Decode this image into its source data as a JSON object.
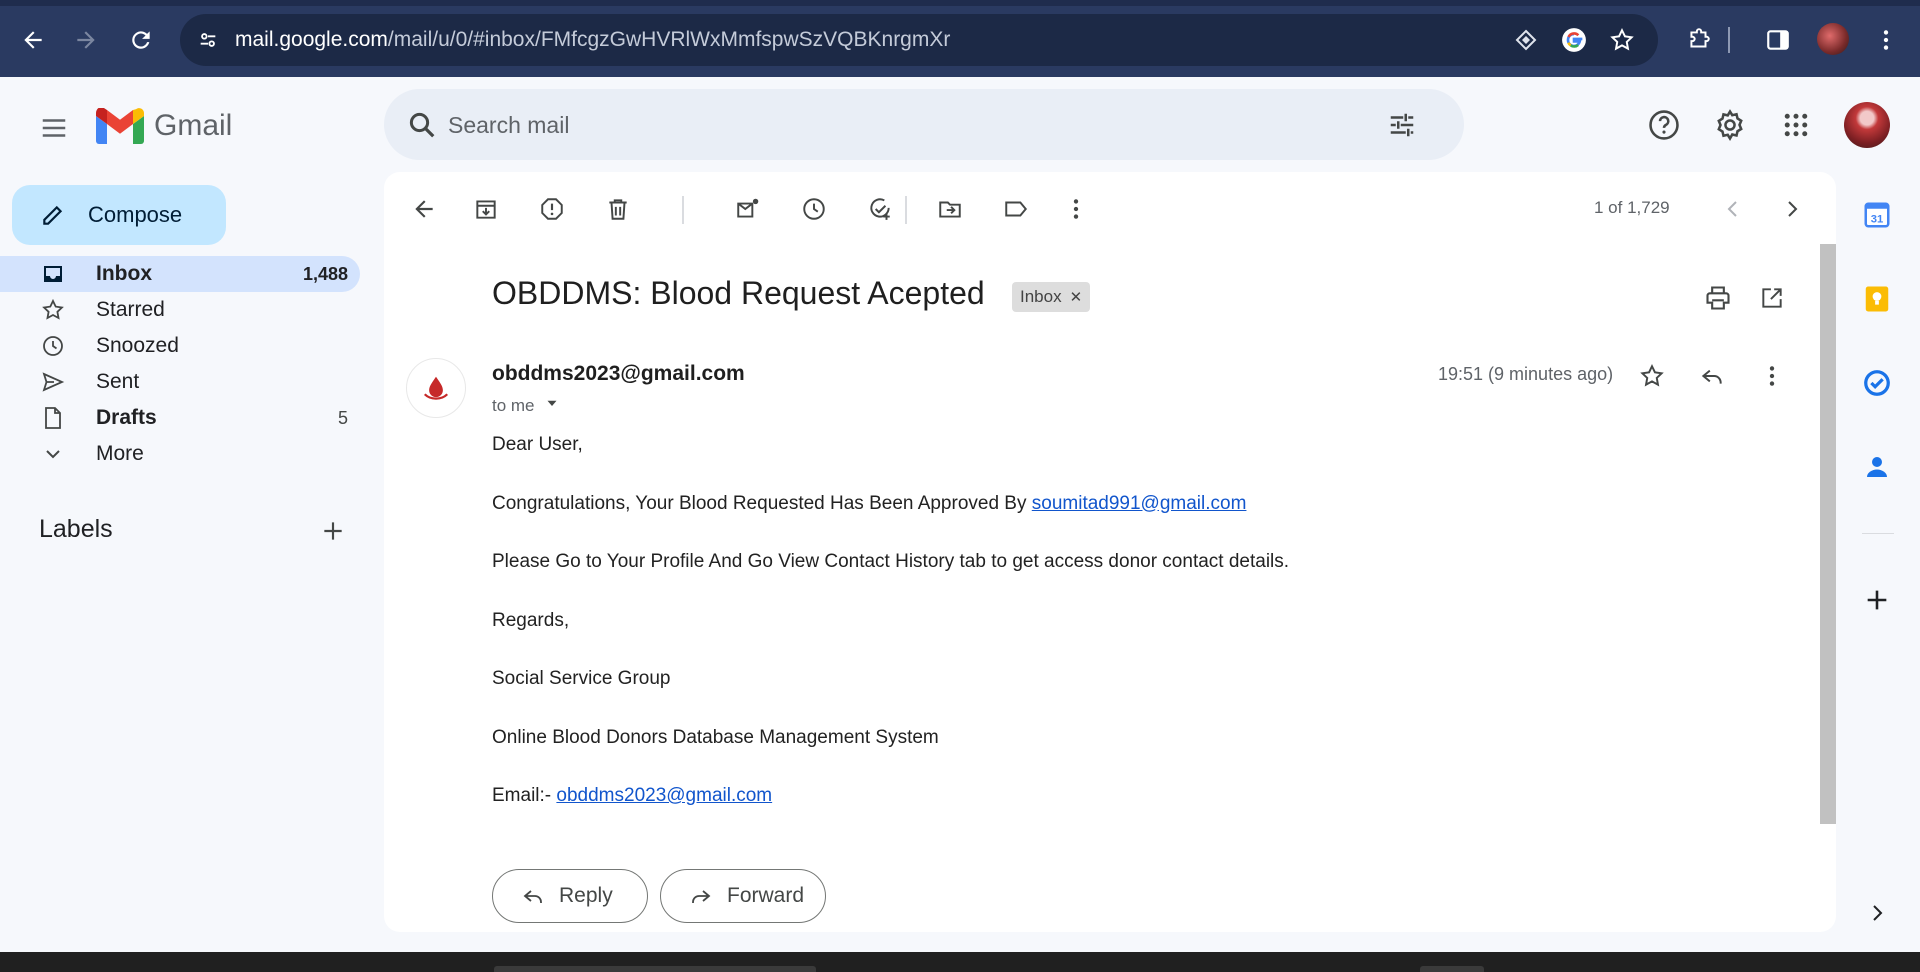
{
  "browser": {
    "url_host": "mail.google.com",
    "url_path": "/mail/u/0/#inbox/FMfcgzGwHVRlWxMmfspwSzVQBKnrgmXr"
  },
  "gmail": {
    "logo_text": "Gmail",
    "search_placeholder": "Search mail"
  },
  "nav": {
    "compose_label": "Compose",
    "items": [
      {
        "label": "Inbox",
        "count": "1,488",
        "icon": "inbox-icon"
      },
      {
        "label": "Starred",
        "count": "",
        "icon": "star-icon"
      },
      {
        "label": "Snoozed",
        "count": "",
        "icon": "clock-icon"
      },
      {
        "label": "Sent",
        "count": "",
        "icon": "send-icon"
      },
      {
        "label": "Drafts",
        "count": "5",
        "icon": "draft-icon"
      },
      {
        "label": "More",
        "count": "",
        "icon": "chevron-down-icon"
      }
    ],
    "labels_heading": "Labels"
  },
  "toolbar": {
    "pager": "1 of 1,729"
  },
  "email": {
    "subject": "OBDDMS: Blood Request Acepted",
    "chip": "Inbox",
    "sender": "obddms2023@gmail.com",
    "recipient": "to me",
    "time": "19:51 (9 minutes ago)",
    "greeting": "Dear User,",
    "line1_prefix": "Congratulations, Your Blood Requested Has Been Approved By ",
    "line1_link": "soumitad991@gmail.com",
    "line2": "Please Go to Your Profile And Go View Contact History tab to get access donor contact details.",
    "regards": "Regards,",
    "group": "Social Service Group",
    "system": "Online Blood Donors Database Management System",
    "email_prefix": "Email:- ",
    "email_link": "obddms2023@gmail.com"
  },
  "actions": {
    "reply": "Reply",
    "forward": "Forward"
  },
  "colors": {
    "chrome_bg": "#2a3a61",
    "compose_bg": "#c2e7ff",
    "active_nav": "#d3e3fd",
    "link": "#1155cc"
  }
}
